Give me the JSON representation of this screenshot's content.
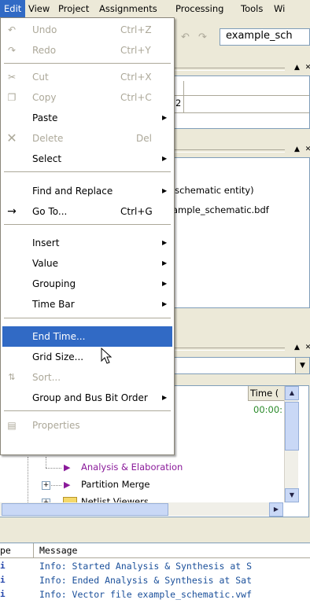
{
  "menubar": {
    "items": [
      "Edit",
      "View",
      "Project",
      "Assignments",
      "Processing",
      "Tools",
      "Wi"
    ]
  },
  "toolbar": {
    "entity_field": "example_sch"
  },
  "top_table": {
    "cell_value": "2"
  },
  "hierarchy_panel": {
    "line1": "'schematic entity)",
    "line2": "ample_schematic.bdf"
  },
  "status_panel": {
    "col_header": "Time (",
    "time_value": "00:00:",
    "rows": [
      "Analysis & Elaboration",
      "Partition Merge",
      "Netlist Viewers"
    ]
  },
  "edit_menu": {
    "items": [
      {
        "icon": "undo-icon",
        "label": "Undo",
        "shortcut": "Ctrl+Z",
        "disabled": true
      },
      {
        "icon": "redo-icon",
        "label": "Redo",
        "shortcut": "Ctrl+Y",
        "disabled": true
      },
      {
        "icon": "cut-icon",
        "label": "Cut",
        "shortcut": "Ctrl+X",
        "disabled": true
      },
      {
        "icon": "copy-icon",
        "label": "Copy",
        "shortcut": "Ctrl+C",
        "disabled": true
      },
      {
        "label": "Paste",
        "submenu": true
      },
      {
        "icon": "delete-icon",
        "label": "Delete",
        "shortcut": "Del",
        "disabled": true
      },
      {
        "label": "Select",
        "submenu": true
      },
      {
        "label": "Find and Replace",
        "submenu": true
      },
      {
        "icon": "goto-arrow-icon",
        "label": "Go To...",
        "shortcut": "Ctrl+G"
      },
      {
        "label": "Insert",
        "submenu": true
      },
      {
        "label": "Value",
        "submenu": true
      },
      {
        "label": "Grouping",
        "submenu": true
      },
      {
        "label": "Time Bar",
        "submenu": true
      },
      {
        "label": "End Time...",
        "highlighted": true
      },
      {
        "label": "Grid Size..."
      },
      {
        "icon": "sort-icon",
        "label": "Sort...",
        "disabled": true
      },
      {
        "label": "Group and Bus Bit Order",
        "submenu": true
      },
      {
        "icon": "properties-icon",
        "label": "Properties",
        "disabled": true
      }
    ]
  },
  "messages": {
    "header_type": "pe",
    "header_message": "Message",
    "rows": [
      "Info: Started Analysis & Synthesis at S",
      "Info: Ended Analysis & Synthesis at Sat",
      "Info: Vector file example_schematic.vwf"
    ]
  },
  "colors": {
    "highlight": "#316ac5",
    "disabled_text": "#aca899",
    "menu_face": "#ece9d8",
    "analysis_arrow": "#8a1a9a"
  }
}
